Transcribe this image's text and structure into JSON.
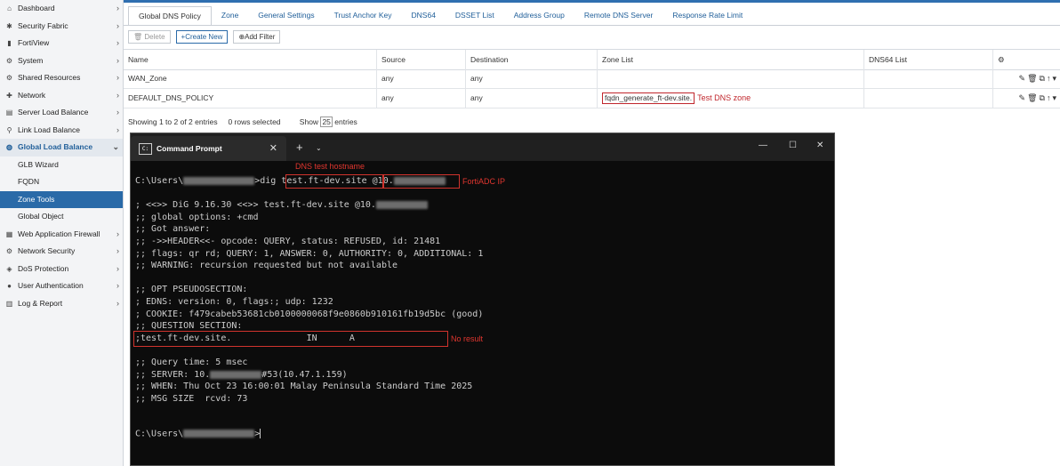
{
  "sidebar": {
    "items": [
      {
        "label": "Dashboard",
        "icon": "dashboard-icon",
        "glyph": "⌂"
      },
      {
        "label": "Security Fabric",
        "icon": "security-fabric-icon",
        "glyph": "✱"
      },
      {
        "label": "FortiView",
        "icon": "fortiview-icon",
        "glyph": "▮"
      },
      {
        "label": "System",
        "icon": "gear-icon",
        "glyph": "⚙"
      },
      {
        "label": "Shared Resources",
        "icon": "shared-resources-icon",
        "glyph": "⚙"
      },
      {
        "label": "Network",
        "icon": "network-icon",
        "glyph": "✚"
      },
      {
        "label": "Server Load Balance",
        "icon": "server-icon",
        "glyph": "▤"
      },
      {
        "label": "Link Load Balance",
        "icon": "link-icon",
        "glyph": "⚲"
      },
      {
        "label": "Global Load Balance",
        "icon": "globe-icon",
        "glyph": "◍"
      }
    ],
    "sub_items": [
      {
        "label": "GLB Wizard"
      },
      {
        "label": "FQDN"
      },
      {
        "label": "Zone Tools"
      },
      {
        "label": "Global Object"
      }
    ],
    "items_after": [
      {
        "label": "Web Application Firewall",
        "icon": "waf-icon",
        "glyph": "▦"
      },
      {
        "label": "Network Security",
        "icon": "network-security-icon",
        "glyph": "⚙"
      },
      {
        "label": "DoS Protection",
        "icon": "shield-icon",
        "glyph": "◈"
      },
      {
        "label": "User Authentication",
        "icon": "user-icon",
        "glyph": "●"
      },
      {
        "label": "Log & Report",
        "icon": "log-icon",
        "glyph": "▥"
      }
    ]
  },
  "tabs": [
    {
      "label": "Global DNS Policy"
    },
    {
      "label": "Zone"
    },
    {
      "label": "General Settings"
    },
    {
      "label": "Trust Anchor Key"
    },
    {
      "label": "DNS64"
    },
    {
      "label": "DSSET List"
    },
    {
      "label": "Address Group"
    },
    {
      "label": "Remote DNS Server"
    },
    {
      "label": "Response Rate Limit"
    }
  ],
  "toolbar": {
    "delete_label": "Delete",
    "create_label": "Create New",
    "filter_label": "Add Filter"
  },
  "table": {
    "columns": [
      "Name",
      "Source",
      "Destination",
      "Zone List",
      "DNS64 List"
    ],
    "rows": [
      {
        "name": "WAN_Zone",
        "source": "any",
        "destination": "any",
        "zone_list": "",
        "dns64": ""
      },
      {
        "name": "DEFAULT_DNS_POLICY",
        "source": "any",
        "destination": "any",
        "zone_list": "fqdn_generate_ft-dev.site.",
        "dns64": ""
      }
    ],
    "zone_annotation": "Test DNS zone",
    "footer": {
      "showing": "Showing 1 to 2 of 2 entries",
      "selected": "0 rows selected",
      "show_label": "Show",
      "page_size": "25",
      "entries_label": "entries"
    }
  },
  "cmd": {
    "title": "Command Prompt",
    "lines": {
      "prompt_prefix": "C:\\Users\\",
      "prompt_suffix": ">dig ",
      "hostname": "test.ft-dev.site",
      "ip_prefix": "@10.",
      "l1a": "; <<>> DiG 9.16.30 <<>> test.ft-dev.site @10.",
      "l2": ";; global options: +cmd",
      "l3": ";; Got answer:",
      "l4": ";; ->>HEADER<<- opcode: QUERY, status: REFUSED, id: 21481",
      "l5": ";; flags: qr rd; QUERY: 1, ANSWER: 0, AUTHORITY: 0, ADDITIONAL: 1",
      "l6": ";; WARNING: recursion requested but not available",
      "l7": ";; OPT PSEUDOSECTION:",
      "l8": "; EDNS: version: 0, flags:; udp: 1232",
      "l9": "; COOKIE: f479cabeb53681cb0100000068f9e0860b910161fb19d5bc (good)",
      "l10": ";; QUESTION SECTION:",
      "l11": ";test.ft-dev.site.              IN      A",
      "l12": ";; Query time: 5 msec",
      "l13a": ";; SERVER: 10.",
      "l13b": "#53(10.47.1.159)",
      "l14": ";; WHEN: Thu Oct 23 16:00:01 Malay Peninsula Standard Time 2025",
      "l15": ";; MSG SIZE  rcvd: 73",
      "final_prefix": "C:\\Users\\",
      "final_suffix": ">"
    },
    "annotations": {
      "hostname": "DNS test hostname",
      "ip": "FortiADC IP",
      "no_result": "No result"
    }
  },
  "colors": {
    "accent": "#2a6aa8",
    "annotation_red": "#d0332d"
  }
}
